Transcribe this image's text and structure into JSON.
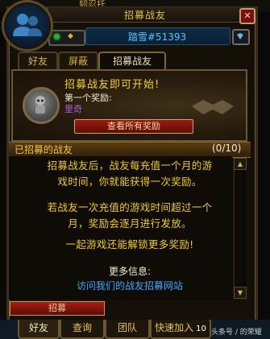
{
  "window": {
    "top_name": "韧忍托",
    "title": "招募战友",
    "close_label": "✕"
  },
  "status": {
    "battletag": "踏雪#51393",
    "status_color": "#25b12b"
  },
  "tabs": [
    {
      "label": "好友",
      "active": false
    },
    {
      "label": "屏蔽",
      "active": false
    },
    {
      "label": "招募战友",
      "active": true
    }
  ],
  "reward": {
    "title": "招募战友即可开始!",
    "subtitle": "第一个奖励:",
    "reward_name": "里奇",
    "reward_color": "#b35be0",
    "view_button": "查看所有奖励"
  },
  "recruited": {
    "header": "已招募的战友",
    "count": "(0/10)"
  },
  "info": {
    "para1_line1": "招募战友后，战友每充值一个月的游",
    "para1_line2": "戏时间，你就能获得一次奖励。",
    "para2_line1": "若战友一次充值的游戏时间超过一个",
    "para2_line2": "月，奖励会逐月进行发放。",
    "para3": "一起游戏还能解锁更多奖励!",
    "more_label": "更多信息:",
    "link_label": "访问我们的战友招募网站"
  },
  "recruit_button": "招募",
  "bottom_tabs": [
    {
      "label": "好友",
      "active": true
    },
    {
      "label": "查询",
      "active": false
    },
    {
      "label": "团队",
      "active": false
    },
    {
      "label": "快速加入",
      "active": false
    }
  ],
  "bottom_tab_badge": "10",
  "watermark": "头条号 / 的荣耀"
}
